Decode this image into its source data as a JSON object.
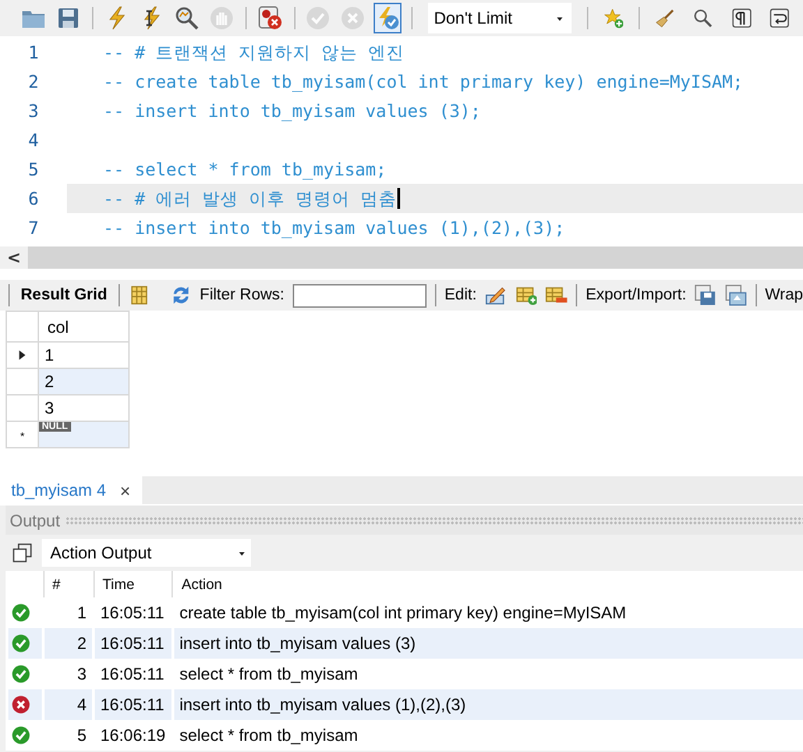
{
  "toolbar": {
    "buttons": [
      {
        "kind": "folder",
        "disabled": false,
        "pressed": false
      },
      {
        "kind": "save",
        "disabled": false,
        "pressed": false
      },
      {
        "kind": "sep"
      },
      {
        "kind": "bolt",
        "disabled": false,
        "pressed": false
      },
      {
        "kind": "bolt-cursor",
        "disabled": false,
        "pressed": false
      },
      {
        "kind": "explain",
        "disabled": false,
        "pressed": false
      },
      {
        "kind": "stop",
        "disabled": true,
        "pressed": false
      },
      {
        "kind": "sep"
      },
      {
        "kind": "error-stop",
        "disabled": false,
        "pressed": false
      },
      {
        "kind": "sep"
      },
      {
        "kind": "commit",
        "disabled": true,
        "pressed": false
      },
      {
        "kind": "rollback",
        "disabled": true,
        "pressed": false
      },
      {
        "kind": "autocommit",
        "disabled": false,
        "pressed": true
      }
    ],
    "limit": "Don't Limit",
    "tools": [
      {
        "kind": "star"
      },
      {
        "kind": "broom"
      },
      {
        "kind": "find"
      },
      {
        "kind": "pilcrow"
      },
      {
        "kind": "wrap"
      }
    ]
  },
  "editor": {
    "lines": [
      {
        "number": "1",
        "text": "-- # 트랜잭션 지원하지 않는 엔진",
        "current": false
      },
      {
        "number": "2",
        "text": "-- create table tb_myisam(col int primary key) engine=MyISAM;",
        "current": false
      },
      {
        "number": "3",
        "text": "-- insert into tb_myisam values (3);",
        "current": false
      },
      {
        "number": "4",
        "current": false
      },
      {
        "number": "5",
        "text": "-- select * from tb_myisam;",
        "current": false
      },
      {
        "number": "6",
        "text": "-- # 에러 발생 이후 명령어 멈춤",
        "current": true
      },
      {
        "number": "7",
        "text": "-- insert into tb_myisam values (1),(2),(3);",
        "current": false
      }
    ],
    "scroll_left": "<"
  },
  "result_toolbar": {
    "tab": "Result Grid",
    "filter_label": "Filter Rows:",
    "edit_label": "Edit:",
    "export_label": "Export/Import:",
    "wrap_label": "Wrap"
  },
  "grid": {
    "columns": [
      "col"
    ],
    "rows": [
      {
        "value": "1",
        "selected": true
      },
      {
        "value": "2",
        "selected": false
      },
      {
        "value": "3",
        "selected": false
      }
    ],
    "new_row": {
      "marker": "*",
      "value": "NULL"
    }
  },
  "result_tabs": [
    {
      "label": "tb_myisam 4",
      "close": "×",
      "selected": true
    }
  ],
  "output": {
    "title": "Output",
    "mode": "Action Output",
    "columns": [
      "#",
      "Time",
      "Action"
    ],
    "rows": [
      {
        "kind": "ok",
        "number": "1",
        "time": "16:05:11",
        "action": "create table tb_myisam(col int primary key) engine=MyISAM"
      },
      {
        "kind": "ok",
        "number": "2",
        "time": "16:05:11",
        "action": "insert into tb_myisam values (3)"
      },
      {
        "kind": "ok",
        "number": "3",
        "time": "16:05:11",
        "action": "select * from tb_myisam"
      },
      {
        "kind": "error",
        "number": "4",
        "time": "16:05:11",
        "action": "insert into tb_myisam values (1),(2),(3)"
      },
      {
        "kind": "ok",
        "number": "5",
        "time": "16:06:19",
        "action": "select * from tb_myisam"
      }
    ]
  }
}
